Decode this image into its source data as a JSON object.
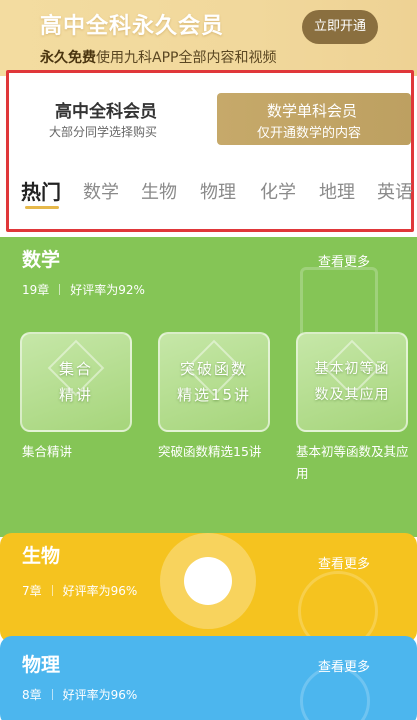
{
  "banner": {
    "title": "高中全科永久会员",
    "subtitle_bold": "永久免费",
    "subtitle_rest": "使用九科APP全部内容和视频",
    "button": "立即开通"
  },
  "membership_tabs": [
    {
      "title": "高中全科会员",
      "desc": "大部分同学选择购买",
      "active": true
    },
    {
      "title": "数学单科会员",
      "desc": "仅开通数学的内容",
      "active": false
    }
  ],
  "subjects": [
    "热门",
    "数学",
    "生物",
    "物理",
    "化学",
    "地理",
    "英语"
  ],
  "active_subject": "热门",
  "cards": {
    "math": {
      "title": "数学",
      "chapters": "19章",
      "rating": "好评率为92%",
      "more": "查看更多",
      "courses": [
        {
          "cover": "集合\n精讲",
          "label": "集合精讲"
        },
        {
          "cover": "突破函数\n精选15讲",
          "label": "突破函数精选15讲"
        },
        {
          "cover": "基本初等函\n数及其应用",
          "label": "基本初等函数及其应用"
        }
      ]
    },
    "bio": {
      "title": "生物",
      "chapters": "7章",
      "rating": "好评率为96%",
      "more": "查看更多"
    },
    "physics": {
      "title": "物理",
      "chapters": "8章",
      "rating": "好评率为96%",
      "more": "查看更多"
    }
  },
  "colors": {
    "math": "#85c556",
    "bio": "#f5c31f",
    "physics": "#4cb6ee",
    "gold": "#bda061",
    "highlight_border": "#e0373a"
  }
}
